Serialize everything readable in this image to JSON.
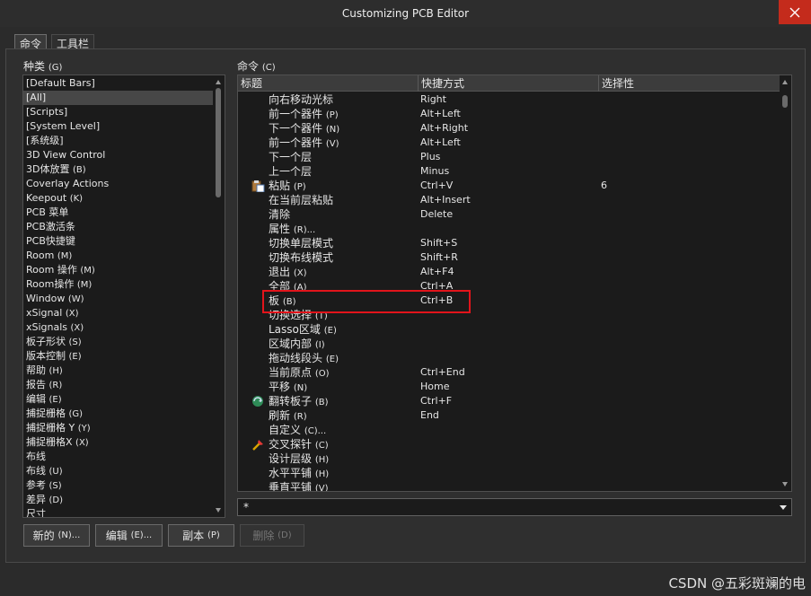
{
  "window": {
    "title": "Customizing PCB Editor"
  },
  "tabs": [
    {
      "label": "命令",
      "active": true
    },
    {
      "label": "工具栏",
      "active": false
    }
  ],
  "categories": {
    "label": "种类",
    "hotkey": "(G)",
    "items": [
      {
        "text": "[Default Bars]",
        "hk": ""
      },
      {
        "text": "[All]",
        "hk": "",
        "selected": true
      },
      {
        "text": "[Scripts]",
        "hk": ""
      },
      {
        "text": "[System Level]",
        "hk": ""
      },
      {
        "text": "[系统级]",
        "hk": ""
      },
      {
        "text": "3D View Control",
        "hk": ""
      },
      {
        "text": "3D体放置",
        "hk": "(B)"
      },
      {
        "text": "Coverlay Actions",
        "hk": ""
      },
      {
        "text": "Keepout",
        "hk": "(K)"
      },
      {
        "text": "PCB 菜单",
        "hk": ""
      },
      {
        "text": "PCB激活条",
        "hk": ""
      },
      {
        "text": "PCB快捷键",
        "hk": ""
      },
      {
        "text": "Room",
        "hk": "(M)"
      },
      {
        "text": "Room 操作",
        "hk": "(M)"
      },
      {
        "text": "Room操作",
        "hk": "(M)"
      },
      {
        "text": "Window",
        "hk": "(W)"
      },
      {
        "text": "xSignal",
        "hk": "(X)"
      },
      {
        "text": "xSignals",
        "hk": "(X)"
      },
      {
        "text": "板子形状",
        "hk": "(S)"
      },
      {
        "text": "版本控制",
        "hk": "(E)"
      },
      {
        "text": "帮助",
        "hk": "(H)"
      },
      {
        "text": "报告",
        "hk": "(R)"
      },
      {
        "text": "编辑",
        "hk": "(E)"
      },
      {
        "text": "捕捉栅格",
        "hk": "(G)"
      },
      {
        "text": "捕捉栅格 Y",
        "hk": "(Y)"
      },
      {
        "text": "捕捉栅格X",
        "hk": "(X)"
      },
      {
        "text": "布线",
        "hk": ""
      },
      {
        "text": "布线",
        "hk": "(U)"
      },
      {
        "text": "参考",
        "hk": "(S)"
      },
      {
        "text": "差异",
        "hk": "(D)"
      },
      {
        "text": "尺寸",
        "hk": ""
      }
    ],
    "scroll_position": 0.0
  },
  "commands": {
    "label": "命令",
    "hotkey": "(C)",
    "columns": [
      "标题",
      "快捷方式",
      "选择性"
    ],
    "rows": [
      {
        "title": "向右移动光标",
        "hk": "",
        "shortcut": "Right",
        "sel": "",
        "icon": ""
      },
      {
        "title": "前一个器件",
        "hk": "(P)",
        "shortcut": "Alt+Left",
        "sel": "",
        "icon": ""
      },
      {
        "title": "下一个器件",
        "hk": "(N)",
        "shortcut": "Alt+Right",
        "sel": "",
        "icon": ""
      },
      {
        "title": "前一个器件",
        "hk": "(V)",
        "shortcut": "Alt+Left",
        "sel": "",
        "icon": ""
      },
      {
        "title": "下一个层",
        "hk": "",
        "shortcut": "Plus",
        "sel": "",
        "icon": ""
      },
      {
        "title": "上一个层",
        "hk": "",
        "shortcut": "Minus",
        "sel": "",
        "icon": ""
      },
      {
        "title": "粘贴",
        "hk": "(P)",
        "shortcut": "Ctrl+V",
        "sel": "6",
        "icon": "paste-icon"
      },
      {
        "title": "在当前层粘贴",
        "hk": "",
        "shortcut": "Alt+Insert",
        "sel": "",
        "icon": ""
      },
      {
        "title": "清除",
        "hk": "",
        "shortcut": "Delete",
        "sel": "",
        "icon": ""
      },
      {
        "title": "属性",
        "hk": "(R)...",
        "shortcut": "",
        "sel": "",
        "icon": ""
      },
      {
        "title": "切换单层模式",
        "hk": "",
        "shortcut": "Shift+S",
        "sel": "",
        "icon": ""
      },
      {
        "title": "切换布线模式",
        "hk": "",
        "shortcut": "Shift+R",
        "sel": "",
        "icon": ""
      },
      {
        "title": "退出",
        "hk": "(X)",
        "shortcut": "Alt+F4",
        "sel": "",
        "icon": ""
      },
      {
        "title": "全部",
        "hk": "(A)",
        "shortcut": "Ctrl+A",
        "sel": "",
        "icon": ""
      },
      {
        "title": "板",
        "hk": "(B)",
        "shortcut": "Ctrl+B",
        "sel": "",
        "icon": "",
        "highlighted": true
      },
      {
        "title": "切换选择",
        "hk": "(T)",
        "shortcut": "",
        "sel": "",
        "icon": ""
      },
      {
        "title": "Lasso区域",
        "hk": "(E)",
        "shortcut": "",
        "sel": "",
        "icon": ""
      },
      {
        "title": "区域内部",
        "hk": "(I)",
        "shortcut": "",
        "sel": "",
        "icon": ""
      },
      {
        "title": "拖动线段头",
        "hk": "(E)",
        "shortcut": "",
        "sel": "",
        "icon": ""
      },
      {
        "title": "当前原点",
        "hk": "(O)",
        "shortcut": "Ctrl+End",
        "sel": "",
        "icon": ""
      },
      {
        "title": "平移",
        "hk": "(N)",
        "shortcut": "Home",
        "sel": "",
        "icon": ""
      },
      {
        "title": "翻转板子",
        "hk": "(B)",
        "shortcut": "Ctrl+F",
        "sel": "",
        "icon": "flip-board-icon"
      },
      {
        "title": "刷新",
        "hk": "(R)",
        "shortcut": "End",
        "sel": "",
        "icon": ""
      },
      {
        "title": "自定义",
        "hk": "(C)...",
        "shortcut": "",
        "sel": "",
        "icon": ""
      },
      {
        "title": "交叉探针",
        "hk": "(C)",
        "shortcut": "",
        "sel": "",
        "icon": "cross-probe-icon"
      },
      {
        "title": "设计层级",
        "hk": "(H)",
        "shortcut": "",
        "sel": "",
        "icon": ""
      },
      {
        "title": "水平平铺",
        "hk": "(H)",
        "shortcut": "",
        "sel": "",
        "icon": ""
      },
      {
        "title": "垂直平铺",
        "hk": "(V)",
        "shortcut": "",
        "sel": "",
        "icon": ""
      }
    ],
    "scroll_position": 0.0
  },
  "filter": {
    "value": "*"
  },
  "buttons": [
    {
      "label": "新的",
      "hk": "(N)...",
      "enabled": true
    },
    {
      "label": "编辑",
      "hk": "(E)...",
      "enabled": true
    },
    {
      "label": "副本",
      "hk": "(P)",
      "enabled": true
    },
    {
      "label": "删除",
      "hk": "(D)",
      "enabled": false
    }
  ],
  "watermark": "CSDN @五彩斑斓的电",
  "colors": {
    "highlight_box": "#e2141b",
    "close_button": "#c42b1c"
  }
}
